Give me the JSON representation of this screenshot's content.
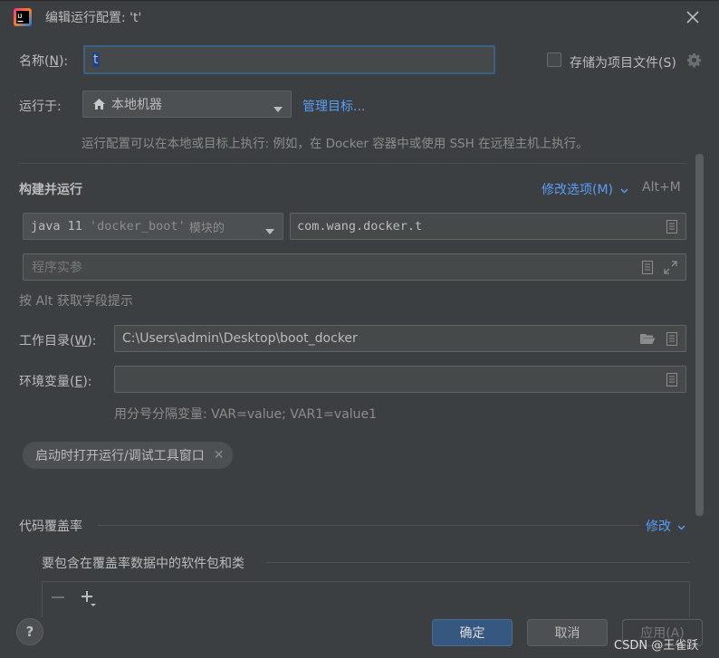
{
  "window": {
    "title": "编辑运行配置: 't'"
  },
  "name_row": {
    "label": "名称",
    "mnemonic": "N",
    "suffix": "):",
    "value": "t",
    "store_label": "存储为项目文件(S)",
    "store_checked": false
  },
  "run_on": {
    "label": "运行于:",
    "value": "本地机器",
    "manage_link": "管理目标...",
    "hint": "运行配置可以在本地或目标上执行: 例如，在 Docker 容器中或使用 SSH 在远程主机上执行。"
  },
  "build_run": {
    "title": "构建并运行",
    "modify_options": "修改选项(M)",
    "shortcut": "Alt+M",
    "jdk_prefix": "java 11 ",
    "jdk_module": "'docker_boot'",
    "jdk_suffix": " 模块的",
    "main_class": "com.wang.docker.t",
    "program_args_placeholder": "程序实参",
    "alt_hint": "按 Alt 获取字段提示"
  },
  "working_dir": {
    "label": "工作目录",
    "mnemonic": "W",
    "suffix": "):",
    "value": "C:\\Users\\admin\\Desktop\\boot_docker"
  },
  "env_vars": {
    "label": "环境变量",
    "mnemonic": "E",
    "suffix": "):",
    "value": "",
    "hint": "用分号分隔变量: VAR=value; VAR1=value1"
  },
  "chip": {
    "label": "启动时打开运行/调试工具窗口"
  },
  "coverage": {
    "title": "代码覆盖率",
    "modify": "修改",
    "include_title": "要包含在覆盖率数据中的软件包和类"
  },
  "buttons": {
    "ok": "确定",
    "cancel": "取消",
    "apply": "应用(A)",
    "help": "?"
  },
  "watermark": "CSDN @王雀跃",
  "colors": {
    "background": "#3c3f41",
    "field": "#45494a",
    "link": "#589df6",
    "primary": "#365880"
  }
}
